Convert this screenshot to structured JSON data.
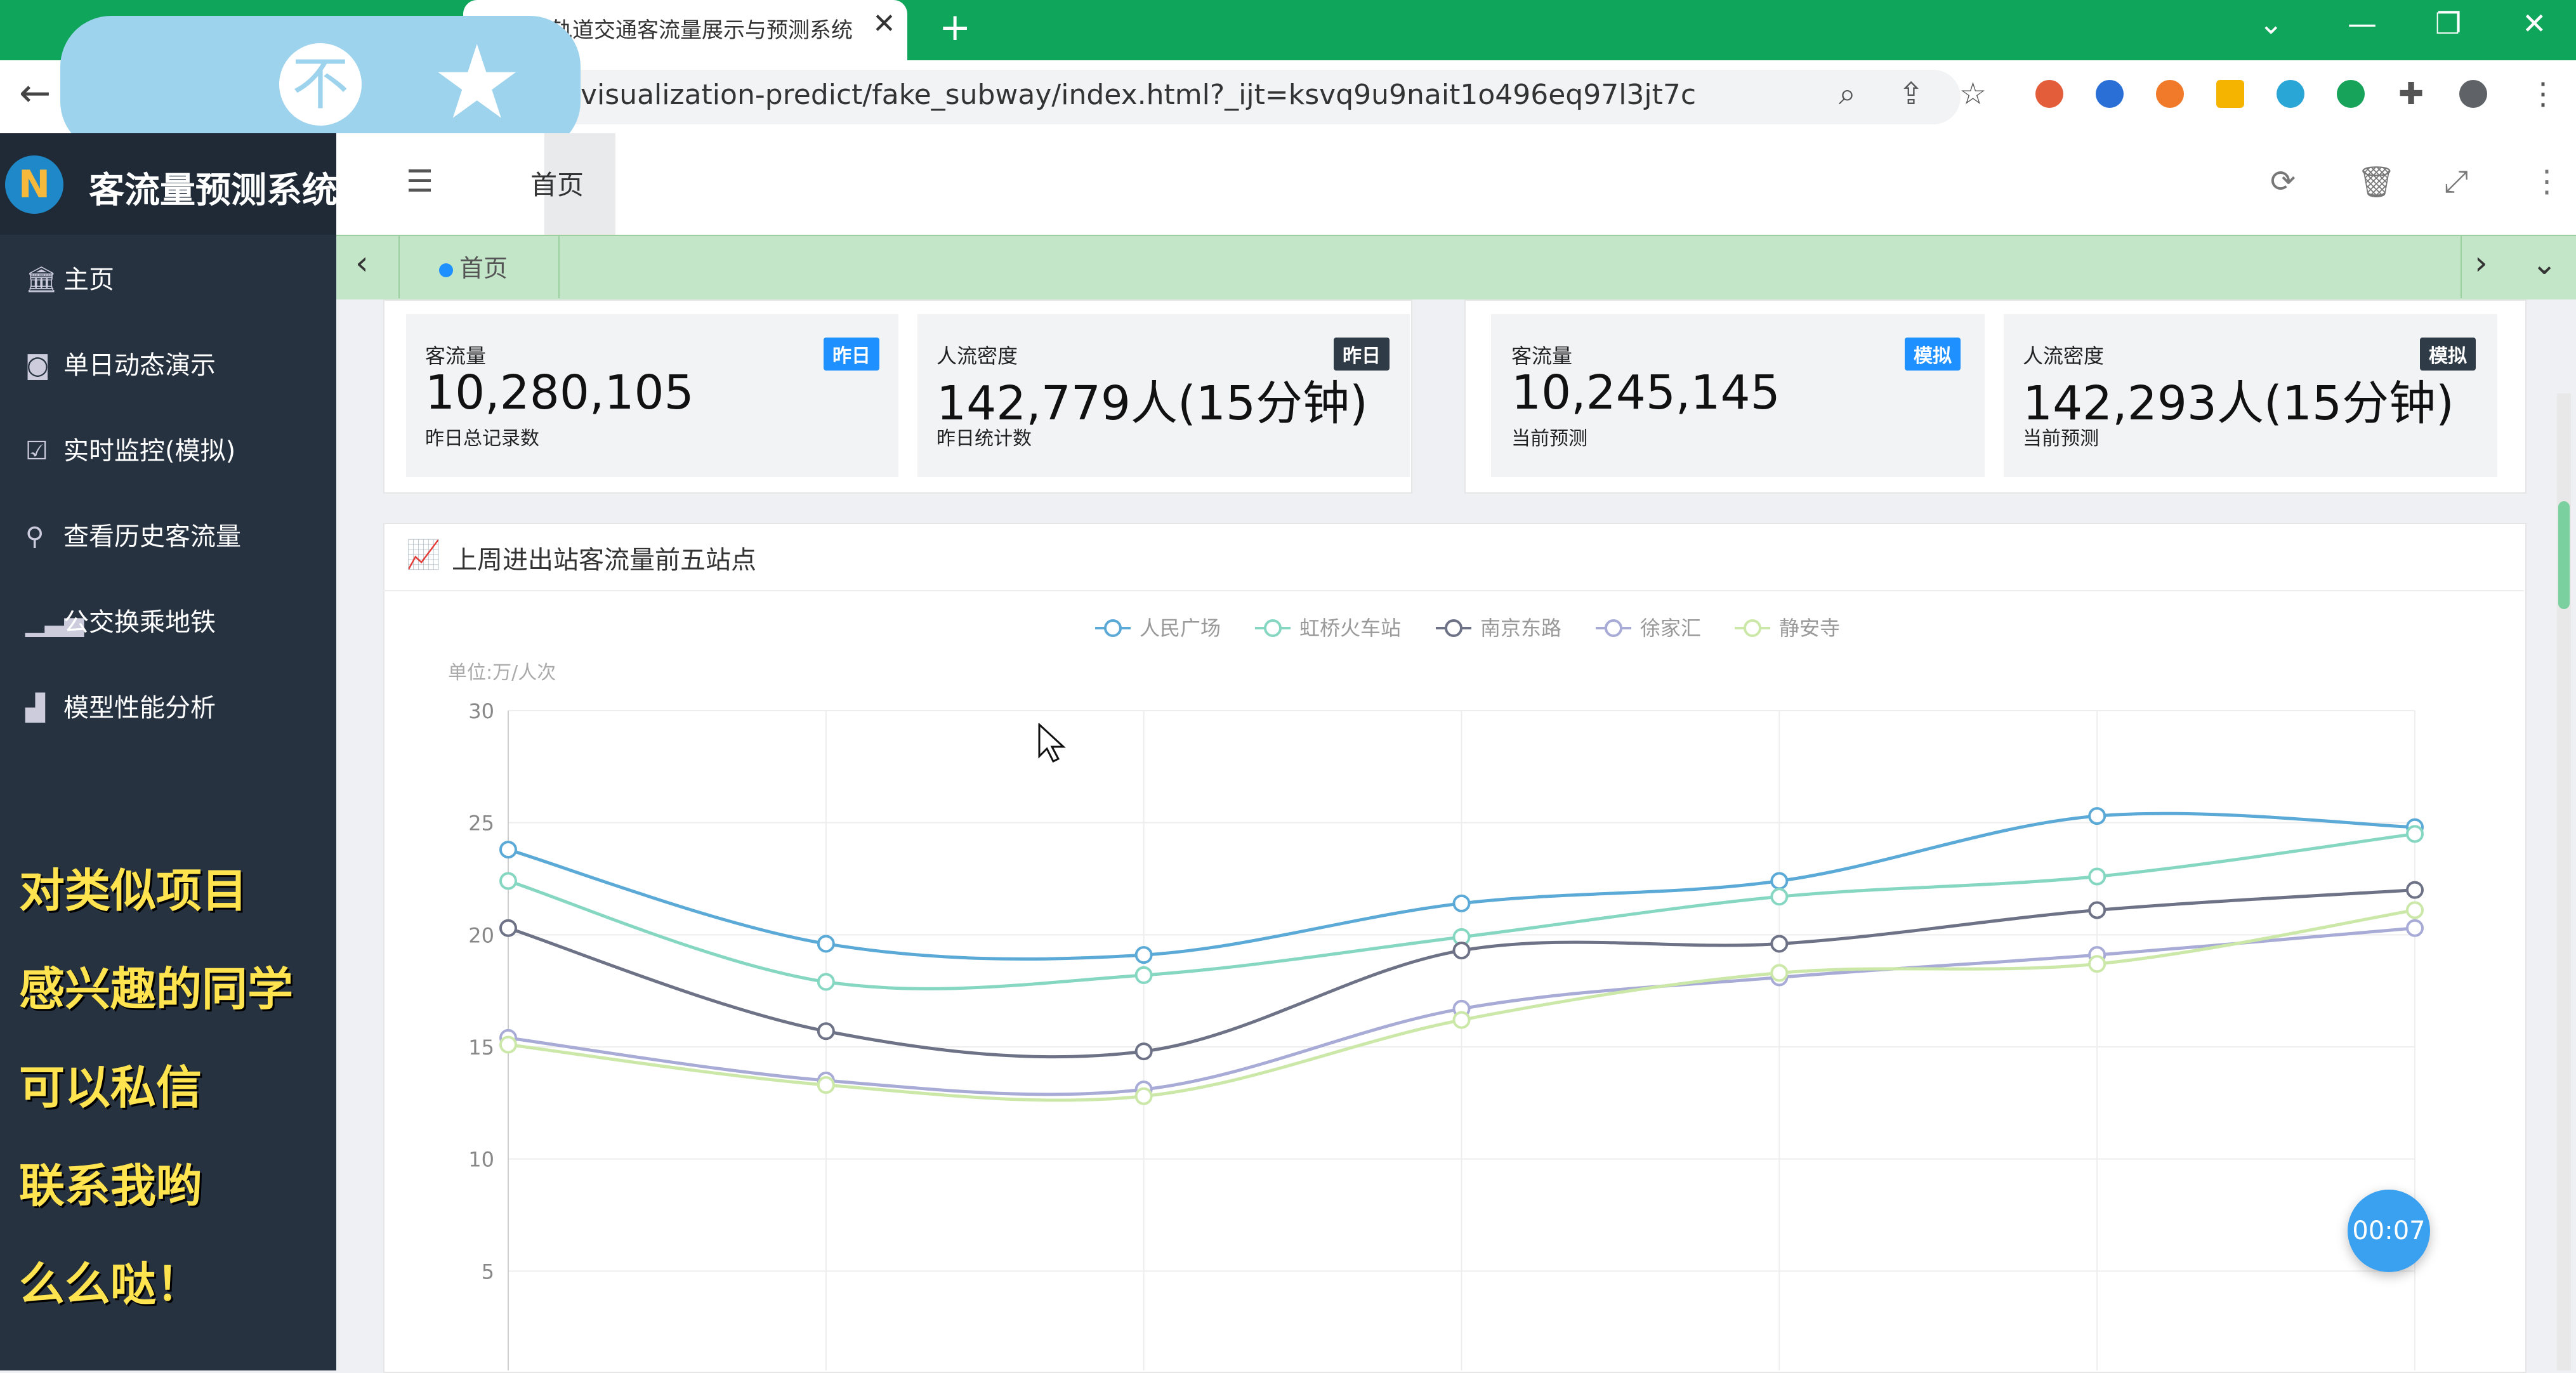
{
  "browser": {
    "tab_title": "轨道交通客流量展示与预测系统",
    "url": "visualization-predict/fake_subway/index.html?_ijt=ksvq9u9nait1o496eq97l3jt7c"
  },
  "sidebar": {
    "title": "客流量预测系统",
    "items": [
      {
        "label": "主页",
        "icon": "bank-icon"
      },
      {
        "label": "单日动态演示",
        "icon": "robot-icon"
      },
      {
        "label": "实时监控(模拟)",
        "icon": "checklist-icon"
      },
      {
        "label": "查看历史客流量",
        "icon": "search-icon"
      },
      {
        "label": "公交换乘地铁",
        "icon": "signal-icon"
      },
      {
        "label": "模型性能分析",
        "icon": "bar-chart-icon"
      }
    ]
  },
  "promo_lines": [
    "对类似项目",
    "感兴趣的同学",
    "可以私信",
    "联系我哟",
    "么么哒！"
  ],
  "appbar": {
    "home_tab": "首页"
  },
  "tagbar": {
    "home_tag": "首页"
  },
  "cards": [
    {
      "label": "客流量",
      "badge": "昨日",
      "badge_color": "#1e90ff",
      "value": "10,280,105",
      "sub": "昨日总记录数"
    },
    {
      "label": "人流密度",
      "badge": "昨日",
      "badge_color": "#2f3b47",
      "value": "142,779人(15分钟)",
      "sub": "昨日统计数"
    },
    {
      "label": "客流量",
      "badge": "模拟",
      "badge_color": "#1e90ff",
      "value": "10,245,145",
      "sub": "当前预测"
    },
    {
      "label": "人流密度",
      "badge": "模拟",
      "badge_color": "#2f3b47",
      "value": "142,293人(15分钟)",
      "sub": "当前预测"
    }
  ],
  "chart_panel_title": "上周进出站客流量前五站点",
  "timer": "00:07",
  "chart_data": {
    "type": "line",
    "title": "上周进出站客流量前五站点",
    "ylabel": "单位:万/人次",
    "ylim": [
      0,
      30
    ],
    "yticks": [
      5,
      10,
      15,
      20,
      25,
      30
    ],
    "grid": true,
    "legend_position": "top-center",
    "smooth": true,
    "series": [
      {
        "name": "人民广场",
        "color": "#5aa9d6",
        "values": [
          23.8,
          19.6,
          19.1,
          21.4,
          22.4,
          25.3,
          24.8
        ]
      },
      {
        "name": "虹桥火车站",
        "color": "#86d7c2",
        "values": [
          22.4,
          17.9,
          18.2,
          19.9,
          21.7,
          22.6,
          24.5
        ]
      },
      {
        "name": "南京东路",
        "color": "#6e7286",
        "values": [
          20.3,
          15.7,
          14.8,
          19.3,
          19.6,
          21.1,
          22.0
        ]
      },
      {
        "name": "徐家汇",
        "color": "#a7abd6",
        "values": [
          15.4,
          13.5,
          13.1,
          16.7,
          18.1,
          19.1,
          20.3
        ]
      },
      {
        "name": "静安寺",
        "color": "#cbe8a8",
        "values": [
          15.1,
          13.3,
          12.8,
          16.2,
          18.3,
          18.7,
          21.1
        ]
      }
    ]
  }
}
